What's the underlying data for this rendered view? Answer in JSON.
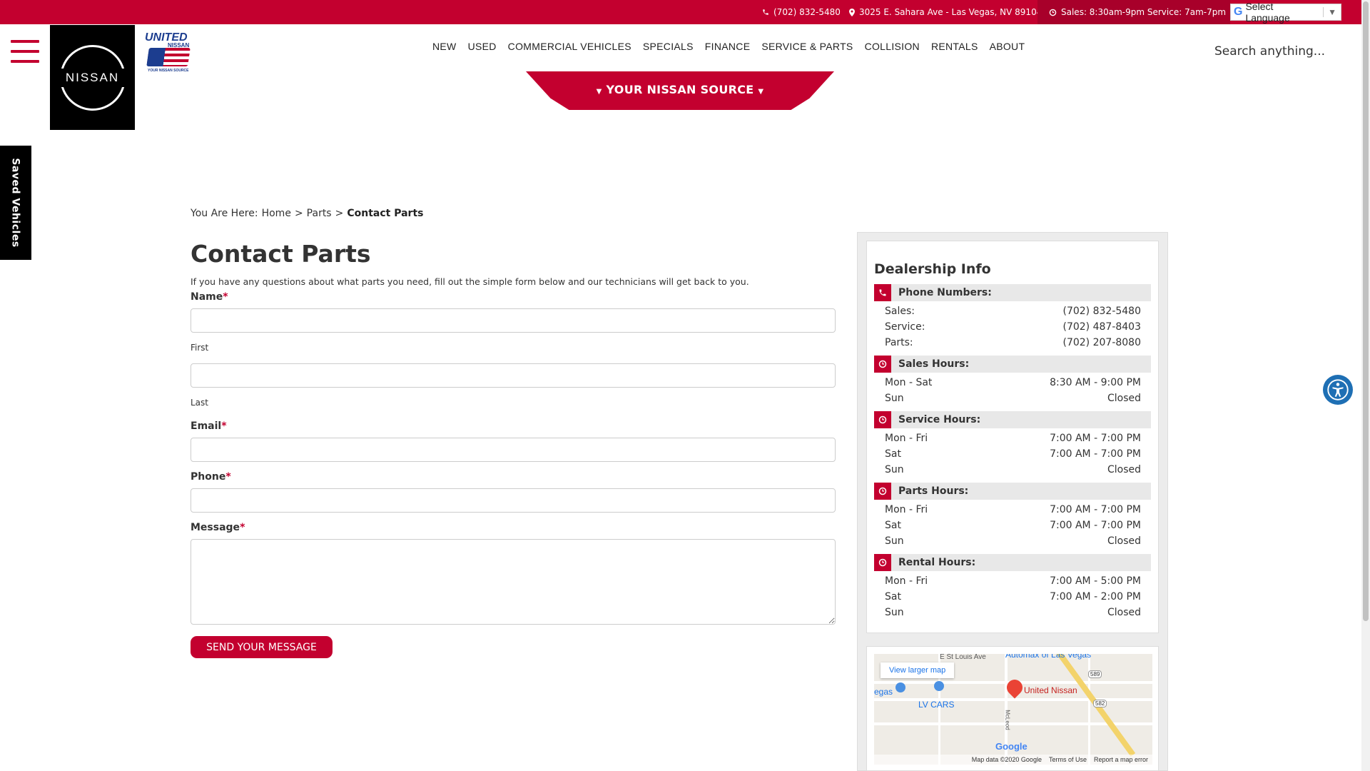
{
  "topbar": {
    "phone": "(702) 832-5480",
    "address": "3025 E. Sahara Ave - Las Vegas, NV 89104",
    "hours": "Sales: 8:30am-9pm  Service: 7am-7pm",
    "language_label": "Select Language"
  },
  "header": {
    "nissan_logo_text": "NISSAN",
    "united_logo": {
      "line1": "UNITED",
      "line2": "NISSAN",
      "tagline": "YOUR NISSAN SOURCE"
    },
    "nav": [
      "NEW",
      "USED",
      "COMMERCIAL VEHICLES",
      "SPECIALS",
      "FINANCE",
      "SERVICE & PARTS",
      "COLLISION",
      "RENTALS",
      "ABOUT"
    ],
    "search_placeholder": "Search anything...",
    "ribbon_label": "YOUR NISSAN SOURCE"
  },
  "saved_vehicles_label": "Saved Vehicles",
  "breadcrumb": {
    "prefix": "You Are Here:",
    "items": [
      "Home",
      "Parts"
    ],
    "current": "Contact Parts",
    "separator": ">"
  },
  "form": {
    "title": "Contact Parts",
    "intro": "If you have any questions about what parts you need, fill out the simple form below and our technicians will get back to you.",
    "name_label": "Name",
    "first_sublabel": "First",
    "last_sublabel": "Last",
    "email_label": "Email",
    "phone_label": "Phone",
    "message_label": "Message",
    "required_mark": "*",
    "submit_label": "SEND YOUR MESSAGE"
  },
  "dealership": {
    "title": "Dealership Info",
    "sections": [
      {
        "title": "Phone Numbers:",
        "icon": "phone-icon",
        "rows": [
          {
            "label": "Sales:",
            "value": "(702) 832-5480"
          },
          {
            "label": "Service:",
            "value": "(702) 487-8403"
          },
          {
            "label": "Parts:",
            "value": "(702) 207-8080"
          }
        ]
      },
      {
        "title": "Sales Hours:",
        "icon": "clock-icon",
        "rows": [
          {
            "label": "Mon - Sat",
            "value": "8:30 AM - 9:00 PM"
          },
          {
            "label": "Sun",
            "value": "Closed"
          }
        ]
      },
      {
        "title": "Service Hours:",
        "icon": "clock-icon",
        "rows": [
          {
            "label": "Mon - Fri",
            "value": "7:00 AM - 7:00 PM"
          },
          {
            "label": "Sat",
            "value": "7:00 AM - 7:00 PM"
          },
          {
            "label": "Sun",
            "value": "Closed"
          }
        ]
      },
      {
        "title": "Parts Hours:",
        "icon": "clock-icon",
        "rows": [
          {
            "label": "Mon - Fri",
            "value": "7:00 AM - 7:00 PM"
          },
          {
            "label": "Sat",
            "value": "7:00 AM - 7:00 PM"
          },
          {
            "label": "Sun",
            "value": "Closed"
          }
        ]
      },
      {
        "title": "Rental Hours:",
        "icon": "clock-icon",
        "rows": [
          {
            "label": "Mon - Fri",
            "value": "7:00 AM - 5:00 PM"
          },
          {
            "label": "Sat",
            "value": "7:00 AM - 2:00 PM"
          },
          {
            "label": "Sun",
            "value": "Closed"
          }
        ]
      }
    ]
  },
  "map": {
    "view_larger": "View larger map",
    "street_top": "E St Louis Ave",
    "automax": "Automax of Las Vegas",
    "pin_label": "United Nissan",
    "lv_cars": "LV CARS",
    "vegas_partial": "egas",
    "mcleod": "McLeod",
    "route_589": "589",
    "route_582": "582",
    "google": "Google",
    "footer": [
      "Map data ©2020 Google",
      "Terms of Use",
      "Report a map error"
    ]
  },
  "colors": {
    "brand_red": "#c3002f",
    "accessibility_blue": "#1e6fb4"
  }
}
